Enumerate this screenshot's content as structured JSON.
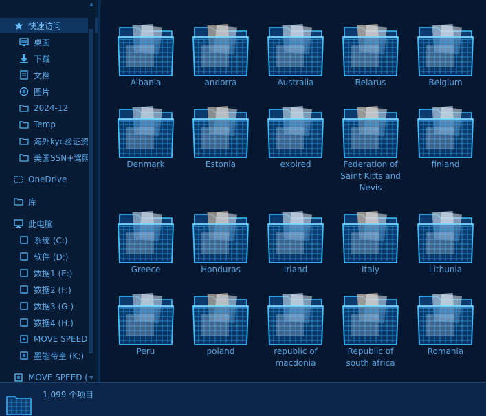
{
  "sidebar": {
    "quick_access": {
      "label": "快速访问",
      "icon": "star-icon"
    },
    "items": [
      {
        "label": "桌面",
        "icon": "desktop-icon",
        "pinned": true
      },
      {
        "label": "下载",
        "icon": "download-icon",
        "pinned": true
      },
      {
        "label": "文档",
        "icon": "document-icon",
        "pinned": true
      },
      {
        "label": "图片",
        "icon": "picture-icon",
        "pinned": true
      },
      {
        "label": "2024-12",
        "icon": "folder-icon",
        "pinned": false
      },
      {
        "label": "Temp",
        "icon": "folder-icon",
        "pinned": false
      },
      {
        "label": "海外kyc验证资",
        "icon": "folder-icon",
        "pinned": false
      },
      {
        "label": "美国SSN+驾照",
        "icon": "folder-icon",
        "pinned": false
      }
    ],
    "onedrive": {
      "label": "OneDrive",
      "icon": "cloud-icon"
    },
    "library": {
      "label": "库",
      "icon": "library-icon"
    },
    "this_pc": {
      "label": "此电脑",
      "icon": "computer-icon"
    },
    "drives": [
      {
        "label": "系统 (C:)"
      },
      {
        "label": "软件 (D:)"
      },
      {
        "label": "数据1 (E:)"
      },
      {
        "label": "数据2 (F:)"
      },
      {
        "label": "数据3 (G:)"
      },
      {
        "label": "数据4 (H:)"
      },
      {
        "label": "MOVE SPEED"
      },
      {
        "label": "墨能帝皇 (K:)"
      }
    ],
    "external": {
      "label": "MOVE SPEED ("
    }
  },
  "folders": [
    {
      "name": "Albania"
    },
    {
      "name": "andorra"
    },
    {
      "name": "Australia"
    },
    {
      "name": "Belarus"
    },
    {
      "name": "Belgium"
    },
    {
      "name": "Denmark"
    },
    {
      "name": "Estonia"
    },
    {
      "name": "expired"
    },
    {
      "name": "Federation of Saint Kitts and Nevis"
    },
    {
      "name": "finland"
    },
    {
      "name": "Greece"
    },
    {
      "name": "Honduras"
    },
    {
      "name": "Irland"
    },
    {
      "name": "Italy"
    },
    {
      "name": "Lithunia"
    },
    {
      "name": "Peru"
    },
    {
      "name": "poland"
    },
    {
      "name": "republic of macdonia"
    },
    {
      "name": "Republic of south africa"
    },
    {
      "name": "Romania"
    }
  ],
  "status": {
    "item_count": "1,099 个项目"
  },
  "colors": {
    "accent": "#1aa8ff",
    "text": "#4fa3e3",
    "background": "#061830"
  }
}
